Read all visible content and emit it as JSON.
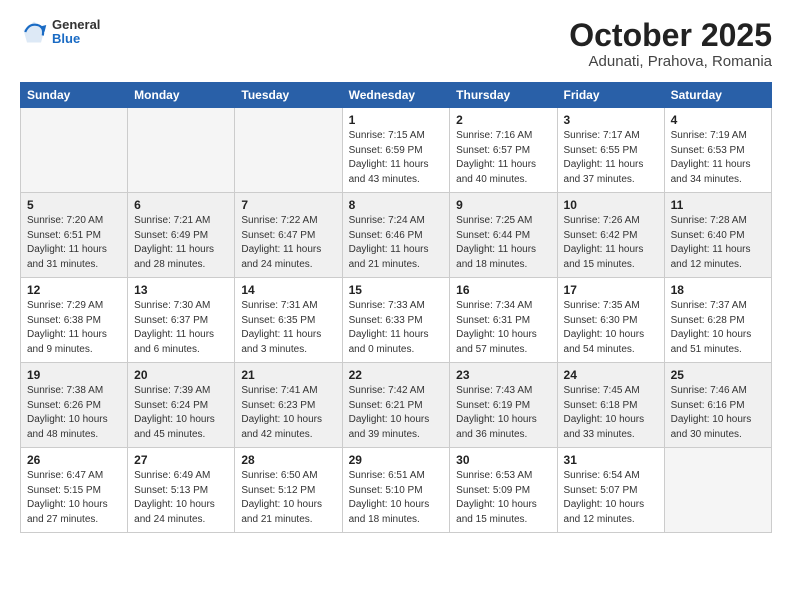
{
  "header": {
    "logo_general": "General",
    "logo_blue": "Blue",
    "title": "October 2025",
    "subtitle": "Adunati, Prahova, Romania"
  },
  "days_of_week": [
    "Sunday",
    "Monday",
    "Tuesday",
    "Wednesday",
    "Thursday",
    "Friday",
    "Saturday"
  ],
  "weeks": [
    [
      {
        "num": "",
        "info": ""
      },
      {
        "num": "",
        "info": ""
      },
      {
        "num": "",
        "info": ""
      },
      {
        "num": "1",
        "info": "Sunrise: 7:15 AM\nSunset: 6:59 PM\nDaylight: 11 hours\nand 43 minutes."
      },
      {
        "num": "2",
        "info": "Sunrise: 7:16 AM\nSunset: 6:57 PM\nDaylight: 11 hours\nand 40 minutes."
      },
      {
        "num": "3",
        "info": "Sunrise: 7:17 AM\nSunset: 6:55 PM\nDaylight: 11 hours\nand 37 minutes."
      },
      {
        "num": "4",
        "info": "Sunrise: 7:19 AM\nSunset: 6:53 PM\nDaylight: 11 hours\nand 34 minutes."
      }
    ],
    [
      {
        "num": "5",
        "info": "Sunrise: 7:20 AM\nSunset: 6:51 PM\nDaylight: 11 hours\nand 31 minutes."
      },
      {
        "num": "6",
        "info": "Sunrise: 7:21 AM\nSunset: 6:49 PM\nDaylight: 11 hours\nand 28 minutes."
      },
      {
        "num": "7",
        "info": "Sunrise: 7:22 AM\nSunset: 6:47 PM\nDaylight: 11 hours\nand 24 minutes."
      },
      {
        "num": "8",
        "info": "Sunrise: 7:24 AM\nSunset: 6:46 PM\nDaylight: 11 hours\nand 21 minutes."
      },
      {
        "num": "9",
        "info": "Sunrise: 7:25 AM\nSunset: 6:44 PM\nDaylight: 11 hours\nand 18 minutes."
      },
      {
        "num": "10",
        "info": "Sunrise: 7:26 AM\nSunset: 6:42 PM\nDaylight: 11 hours\nand 15 minutes."
      },
      {
        "num": "11",
        "info": "Sunrise: 7:28 AM\nSunset: 6:40 PM\nDaylight: 11 hours\nand 12 minutes."
      }
    ],
    [
      {
        "num": "12",
        "info": "Sunrise: 7:29 AM\nSunset: 6:38 PM\nDaylight: 11 hours\nand 9 minutes."
      },
      {
        "num": "13",
        "info": "Sunrise: 7:30 AM\nSunset: 6:37 PM\nDaylight: 11 hours\nand 6 minutes."
      },
      {
        "num": "14",
        "info": "Sunrise: 7:31 AM\nSunset: 6:35 PM\nDaylight: 11 hours\nand 3 minutes."
      },
      {
        "num": "15",
        "info": "Sunrise: 7:33 AM\nSunset: 6:33 PM\nDaylight: 11 hours\nand 0 minutes."
      },
      {
        "num": "16",
        "info": "Sunrise: 7:34 AM\nSunset: 6:31 PM\nDaylight: 10 hours\nand 57 minutes."
      },
      {
        "num": "17",
        "info": "Sunrise: 7:35 AM\nSunset: 6:30 PM\nDaylight: 10 hours\nand 54 minutes."
      },
      {
        "num": "18",
        "info": "Sunrise: 7:37 AM\nSunset: 6:28 PM\nDaylight: 10 hours\nand 51 minutes."
      }
    ],
    [
      {
        "num": "19",
        "info": "Sunrise: 7:38 AM\nSunset: 6:26 PM\nDaylight: 10 hours\nand 48 minutes."
      },
      {
        "num": "20",
        "info": "Sunrise: 7:39 AM\nSunset: 6:24 PM\nDaylight: 10 hours\nand 45 minutes."
      },
      {
        "num": "21",
        "info": "Sunrise: 7:41 AM\nSunset: 6:23 PM\nDaylight: 10 hours\nand 42 minutes."
      },
      {
        "num": "22",
        "info": "Sunrise: 7:42 AM\nSunset: 6:21 PM\nDaylight: 10 hours\nand 39 minutes."
      },
      {
        "num": "23",
        "info": "Sunrise: 7:43 AM\nSunset: 6:19 PM\nDaylight: 10 hours\nand 36 minutes."
      },
      {
        "num": "24",
        "info": "Sunrise: 7:45 AM\nSunset: 6:18 PM\nDaylight: 10 hours\nand 33 minutes."
      },
      {
        "num": "25",
        "info": "Sunrise: 7:46 AM\nSunset: 6:16 PM\nDaylight: 10 hours\nand 30 minutes."
      }
    ],
    [
      {
        "num": "26",
        "info": "Sunrise: 6:47 AM\nSunset: 5:15 PM\nDaylight: 10 hours\nand 27 minutes."
      },
      {
        "num": "27",
        "info": "Sunrise: 6:49 AM\nSunset: 5:13 PM\nDaylight: 10 hours\nand 24 minutes."
      },
      {
        "num": "28",
        "info": "Sunrise: 6:50 AM\nSunset: 5:12 PM\nDaylight: 10 hours\nand 21 minutes."
      },
      {
        "num": "29",
        "info": "Sunrise: 6:51 AM\nSunset: 5:10 PM\nDaylight: 10 hours\nand 18 minutes."
      },
      {
        "num": "30",
        "info": "Sunrise: 6:53 AM\nSunset: 5:09 PM\nDaylight: 10 hours\nand 15 minutes."
      },
      {
        "num": "31",
        "info": "Sunrise: 6:54 AM\nSunset: 5:07 PM\nDaylight: 10 hours\nand 12 minutes."
      },
      {
        "num": "",
        "info": ""
      }
    ]
  ]
}
